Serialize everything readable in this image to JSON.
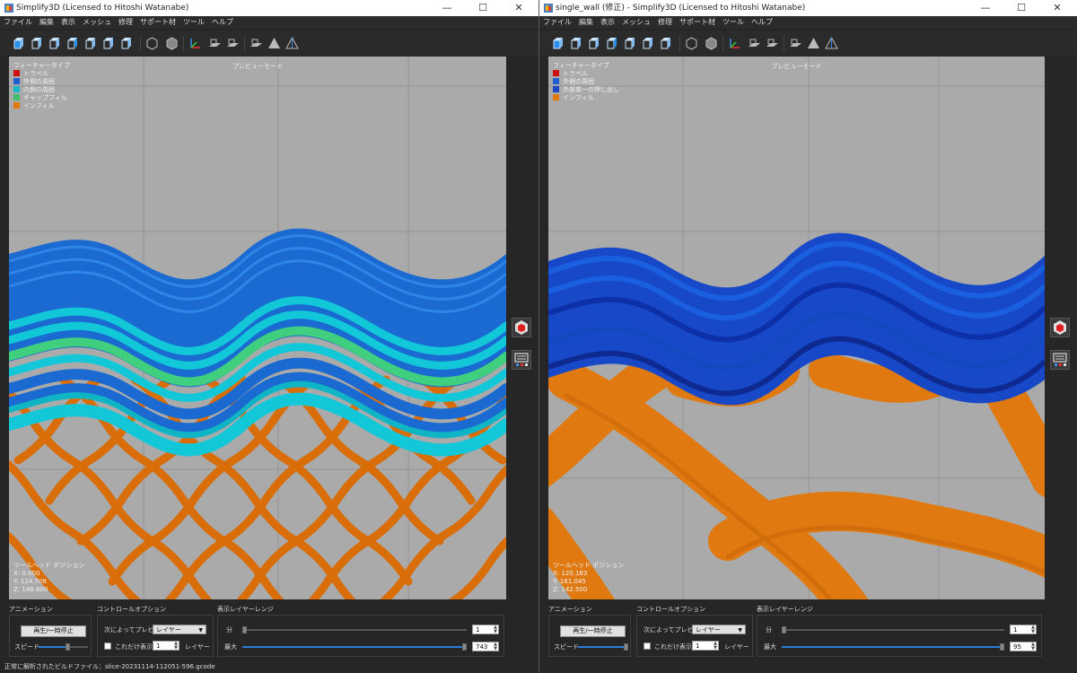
{
  "left_window": {
    "title": "Simplify3D (Licensed to Hitoshi Watanabe)",
    "menu": [
      "ファイル",
      "編集",
      "表示",
      "メッシュ",
      "修理",
      "サポート材",
      "ツール",
      "ヘルプ"
    ],
    "viewport": {
      "mode_label": "プレビューモード",
      "legend_title": "フィーチャータイプ",
      "legend": [
        {
          "label": "トラベル",
          "color": "#cc1111"
        },
        {
          "label": "外側の周囲",
          "color": "#1f5fd0"
        },
        {
          "label": "内側の周囲",
          "color": "#19b8c8"
        },
        {
          "label": "ギャップフィル",
          "color": "#3fbf6f"
        },
        {
          "label": "インフィル",
          "color": "#e07a10"
        }
      ],
      "tool_position_title": "ツールヘッド ポジション",
      "x": "X: 0.000",
      "y": "Y: 124.708",
      "z": "Z: 148.600"
    },
    "controls": {
      "animation_label": "アニメーション",
      "play_pause": "再生/一時停止",
      "speed_label": "スピード",
      "control_options_label": "コントロールオプション",
      "preview_by_label": "次によってプレビュー",
      "preview_by_value": "レイヤー",
      "show_only_label": "これだけ表示",
      "show_only_value": "1",
      "layer_word": "レイヤー",
      "range_label": "表示レイヤーレンジ",
      "min_label": "分",
      "min_value": "1",
      "max_label": "最大",
      "max_value": "743",
      "speed_level": 0.6
    },
    "status": "正常に解析されたビルドファイル：slice-20231114-112051-596.gcode"
  },
  "right_window": {
    "title": "single_wall (修正) - Simplify3D (Licensed to Hitoshi Watanabe)",
    "menu": [
      "ファイル",
      "編集",
      "表示",
      "メッシュ",
      "修理",
      "サポート材",
      "ツール",
      "ヘルプ"
    ],
    "viewport": {
      "mode_label": "プレビューモード",
      "legend_title": "フィーチャータイプ",
      "legend": [
        {
          "label": "トラベル",
          "color": "#cc1111"
        },
        {
          "label": "外側の周囲",
          "color": "#1f5fd0"
        },
        {
          "label": "外部単一の押し出し",
          "color": "#1848c8"
        },
        {
          "label": "インフィル",
          "color": "#e07a10"
        }
      ],
      "tool_position_title": "ツールヘッド ポジション",
      "x": "X: 120.183",
      "y": "Y: 161.045",
      "z": "Z: 142.500"
    },
    "controls": {
      "animation_label": "アニメーション",
      "play_pause": "再生/一時停止",
      "speed_label": "スピード",
      "control_options_label": "コントロールオプション",
      "preview_by_label": "次によってプレビュー",
      "preview_by_value": "レイヤー",
      "show_only_label": "これだけ表示",
      "show_only_value": "1",
      "layer_word": "レイヤー",
      "range_label": "表示レイヤーレンジ",
      "min_label": "分",
      "min_value": "1",
      "max_label": "最大",
      "max_value": "95",
      "speed_level": 0.98
    }
  },
  "window_controls": {
    "minimize": "—",
    "maximize": "☐",
    "close": "✕"
  },
  "colors": {
    "viewport_bg": "#aaaaaa",
    "outer_perimeter": "#1f5fd0",
    "inner_perimeter": "#19b8c8",
    "gap_fill": "#3fbf6f",
    "infill": "#e07a10",
    "accent": "#2d7bd9"
  },
  "toolbar_icons": [
    "cube-front-icon",
    "cube-back-icon",
    "cube-left-icon",
    "cube-right-icon",
    "cube-top-icon",
    "cube-bottom-icon",
    "cube-iso-icon",
    "wireframe-icon",
    "solid-icon",
    "axes-icon",
    "bed-icon",
    "build-volume-icon",
    "shadow-icon",
    "cross-section-icon",
    "layer-view-icon"
  ],
  "side_icons": [
    "show-model-icon",
    "preview-settings-icon"
  ]
}
